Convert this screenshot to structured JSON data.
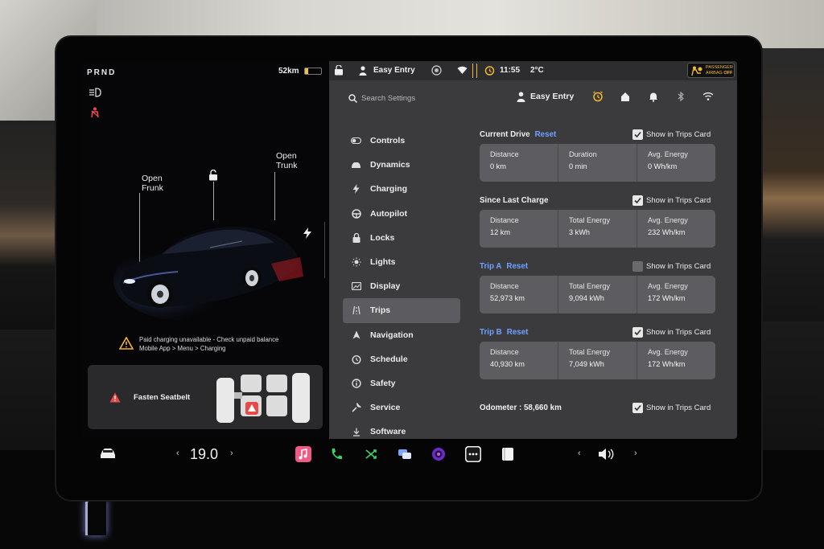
{
  "left": {
    "gear": "PRND",
    "range": "52km",
    "battery_level": 0.2,
    "frunk_label": "Open\nFrunk",
    "frunk_line1": "Open",
    "frunk_line2": "Frunk",
    "trunk_line1": "Open",
    "trunk_line2": "Trunk",
    "warning_line1": "Paid charging unavailable - Check unpaid balance",
    "warning_line2": "Mobile App > Menu > Charging",
    "seatbelt_alert": "Fasten Seatbelt"
  },
  "status_bar": {
    "profile": "Easy Entry",
    "time": "11:55",
    "temperature": "2°C",
    "airbag_line1": "PASSENGER",
    "airbag_line2": "AIRBAG",
    "airbag_state": "OFF"
  },
  "search": {
    "placeholder": "Search Settings"
  },
  "profile": {
    "name": "Easy Entry"
  },
  "menu": {
    "items": [
      {
        "label": "Controls",
        "icon": "toggle-icon"
      },
      {
        "label": "Dynamics",
        "icon": "car-icon"
      },
      {
        "label": "Charging",
        "icon": "bolt-icon"
      },
      {
        "label": "Autopilot",
        "icon": "steering-wheel-icon"
      },
      {
        "label": "Locks",
        "icon": "lock-icon"
      },
      {
        "label": "Lights",
        "icon": "sun-icon"
      },
      {
        "label": "Display",
        "icon": "display-icon"
      },
      {
        "label": "Trips",
        "icon": "trips-icon",
        "active": true
      },
      {
        "label": "Navigation",
        "icon": "navigation-icon"
      },
      {
        "label": "Schedule",
        "icon": "clock-icon"
      },
      {
        "label": "Safety",
        "icon": "info-icon"
      },
      {
        "label": "Service",
        "icon": "wrench-icon"
      },
      {
        "label": "Software",
        "icon": "download-icon"
      }
    ]
  },
  "trips": {
    "show_label": "Show in Trips Card",
    "reset_label": "Reset",
    "current_drive": {
      "title": "Current Drive",
      "show": true,
      "cells": [
        {
          "label": "Distance",
          "value": "0 km"
        },
        {
          "label": "Duration",
          "value": "0 min"
        },
        {
          "label": "Avg. Energy",
          "value": "0 Wh/km"
        }
      ]
    },
    "since_last_charge": {
      "title": "Since Last Charge",
      "show": true,
      "cells": [
        {
          "label": "Distance",
          "value": "12 km"
        },
        {
          "label": "Total Energy",
          "value": "3 kWh"
        },
        {
          "label": "Avg. Energy",
          "value": "232 Wh/km"
        }
      ]
    },
    "trip_a": {
      "title": "Trip A",
      "show": false,
      "cells": [
        {
          "label": "Distance",
          "value": "52,973 km"
        },
        {
          "label": "Total Energy",
          "value": "9,094 kWh"
        },
        {
          "label": "Avg. Energy",
          "value": "172 Wh/km"
        }
      ]
    },
    "trip_b": {
      "title": "Trip B",
      "show": true,
      "cells": [
        {
          "label": "Distance",
          "value": "40,930 km"
        },
        {
          "label": "Total Energy",
          "value": "7,049 kWh"
        },
        {
          "label": "Avg. Energy",
          "value": "172 Wh/km"
        }
      ]
    },
    "odometer": "Odometer : 58,660 km",
    "odometer_show": true
  },
  "dock": {
    "temperature": "19.0",
    "temp_left": "‹",
    "temp_right": "›",
    "vol_left": "‹",
    "vol_right": "›"
  },
  "colors": {
    "accent_blue": "#6fa0ff",
    "warning_yellow": "#f2b630",
    "alert_red": "#e84a4a",
    "panel_bg": "#3b3b3e",
    "card_bg": "#5d5d61"
  }
}
